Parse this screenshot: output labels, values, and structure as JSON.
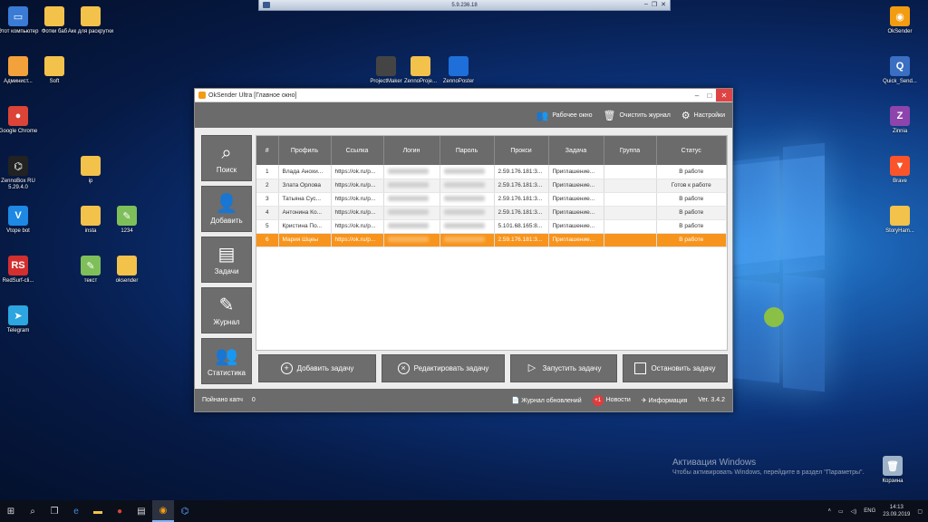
{
  "remote_bar": {
    "title": "5.9.236.18"
  },
  "desktop_icons_left": [
    {
      "name": "computer",
      "label": "Этот компьютер",
      "color": "#3a7bd5",
      "glyph": "▭"
    },
    {
      "name": "fotki",
      "label": "Фотки баб",
      "color": "#f2c24b",
      "glyph": ""
    },
    {
      "name": "akk",
      "label": "Акк для раскрутки",
      "color": "#f2c24b",
      "glyph": ""
    },
    {
      "name": "admin",
      "label": "Админист...",
      "color": "#f2a13b",
      "glyph": ""
    },
    {
      "name": "soft",
      "label": "Soft",
      "color": "#f2c24b",
      "glyph": ""
    },
    {
      "name": "chrome",
      "label": "Google Chrome",
      "color": "#db4437",
      "glyph": "●"
    },
    {
      "name": "zennobox",
      "label": "ZennoBox RU 5.29.4.0",
      "color": "#222",
      "glyph": "⌬"
    },
    {
      "name": "ip",
      "label": "ip",
      "color": "#f2c24b",
      "glyph": ""
    },
    {
      "name": "vtope",
      "label": "Vtope bot",
      "color": "#1e88e5",
      "glyph": "V"
    },
    {
      "name": "insta",
      "label": "insta",
      "color": "#f2c24b",
      "glyph": ""
    },
    {
      "name": "n1234",
      "label": "1234",
      "color": "#7fbf5a",
      "glyph": "✎"
    },
    {
      "name": "redsurf",
      "label": "RedSurf-cli...",
      "color": "#d32f2f",
      "glyph": "RS"
    },
    {
      "name": "tekst",
      "label": "текст",
      "color": "#7fbf5a",
      "glyph": "✎"
    },
    {
      "name": "oksender",
      "label": "oksender",
      "color": "#f2c24b",
      "glyph": ""
    },
    {
      "name": "telegram",
      "label": "Telegram",
      "color": "#2ca5e0",
      "glyph": "➤"
    }
  ],
  "desktop_icons_top": [
    {
      "label": "ProjectMaker",
      "color": "#444"
    },
    {
      "label": "ZennoProje...",
      "color": "#f2c24b"
    },
    {
      "label": "ZennoPoster",
      "color": "#1e6fd9"
    }
  ],
  "desktop_icons_right": [
    {
      "label": "OkSender",
      "color": "#f39c12",
      "glyph": "◉"
    },
    {
      "label": "Quick_Send...",
      "color": "#3a6fc2",
      "glyph": "Q"
    },
    {
      "label": "Zinnia",
      "color": "#8e44ad",
      "glyph": "Z"
    },
    {
      "label": "Brave",
      "color": "#fb542b",
      "glyph": "▼"
    },
    {
      "label": "StoryHam...",
      "color": "#f2c24b",
      "glyph": ""
    },
    {
      "label": "Корзина",
      "color": "#9fb3c8",
      "glyph": "🗑"
    }
  ],
  "app": {
    "title": "OkSender Ultra [Главное окно]",
    "toolbar": {
      "workspace": "Рабочее окно",
      "clear_log": "Очистить журнал",
      "settings": "Настройки"
    },
    "sidebar": [
      {
        "key": "search",
        "label": "Поиск",
        "icon": "⌕"
      },
      {
        "key": "add",
        "label": "Добавить",
        "icon": "👤"
      },
      {
        "key": "tasks",
        "label": "Задачи",
        "icon": "▤"
      },
      {
        "key": "journal",
        "label": "Журнал",
        "icon": "✎"
      },
      {
        "key": "stats",
        "label": "Статистика",
        "icon": "👥"
      }
    ],
    "table": {
      "columns": [
        "#",
        "Профиль",
        "Ссылка",
        "Логин",
        "Пароль",
        "Прокси",
        "Задача",
        "Группа",
        "Статус"
      ],
      "rows": [
        {
          "n": "1",
          "profile": "Влада Анохи...",
          "link": "https://ok.ru/p...",
          "proxy": "2.59.176.181:3...",
          "task": "Приглашение...",
          "group": "",
          "status": "В работе"
        },
        {
          "n": "2",
          "profile": "Злата Орлова",
          "link": "https://ok.ru/p...",
          "proxy": "2.59.176.181:3...",
          "task": "Приглашение...",
          "group": "",
          "status": "Готов к работе"
        },
        {
          "n": "3",
          "profile": "Татьяна Сус...",
          "link": "https://ok.ru/p...",
          "proxy": "2.59.176.181:3...",
          "task": "Приглашение...",
          "group": "",
          "status": "В работе"
        },
        {
          "n": "4",
          "profile": "Антонина Ко...",
          "link": "https://ok.ru/p...",
          "proxy": "2.59.176.181:3...",
          "task": "Приглашение...",
          "group": "",
          "status": "В работе"
        },
        {
          "n": "5",
          "profile": "Кристина По...",
          "link": "https://ok.ru/p...",
          "proxy": "5.101.68.165:8...",
          "task": "Приглашение...",
          "group": "",
          "status": "В работе"
        },
        {
          "n": "6",
          "profile": "Мария Шцеы",
          "link": "https://ok.ru/p...",
          "proxy": "2.59.176.181:3...",
          "task": "Приглашение...",
          "group": "",
          "status": "В работе"
        }
      ]
    },
    "actions": {
      "add_task": "Добавить задачу",
      "edit_task": "Редактировать задачу",
      "start_task": "Запустить задачу",
      "stop_task": "Остановить задачу"
    },
    "statusbar": {
      "captcha_label": "Пойнано капч",
      "captcha_value": "0",
      "update_log": "Журнал обновлений",
      "news_badge": "+1",
      "news": "Новости",
      "info": "Информация",
      "version": "Ver. 3.4.2"
    }
  },
  "watermark": {
    "line1": "Активация Windows",
    "line2": "Чтобы активировать Windows, перейдите в раздел \"Параметры\"."
  },
  "taskbar": {
    "lang": "ENG",
    "time": "14:13",
    "date": "23.09.2019"
  },
  "colors": {
    "accent_orange": "#f7941d",
    "panel_gray": "#6b6b6b"
  }
}
